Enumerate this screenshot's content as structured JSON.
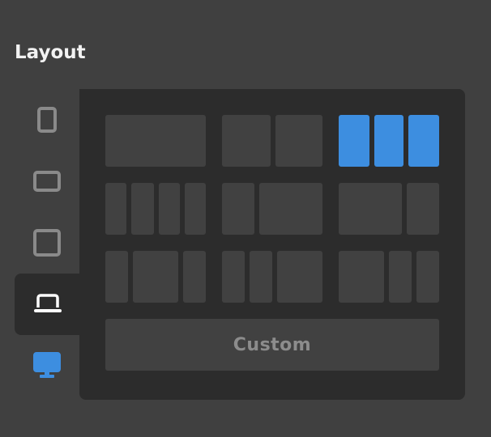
{
  "title": "Layout",
  "devices": [
    {
      "name": "phone",
      "icon": "phone-portrait-icon",
      "selected": false
    },
    {
      "name": "phone-landscape",
      "icon": "phone-landscape-icon",
      "selected": false
    },
    {
      "name": "tablet",
      "icon": "tablet-icon",
      "selected": false
    },
    {
      "name": "laptop",
      "icon": "laptop-icon",
      "selected": true
    },
    {
      "name": "desktop",
      "icon": "desktop-icon",
      "selected": false
    }
  ],
  "layout_options": [
    {
      "id": "1-col",
      "columns": [
        1
      ],
      "selected": false
    },
    {
      "id": "2-col-equal",
      "columns": [
        1,
        1
      ],
      "selected": false
    },
    {
      "id": "3-col-equal",
      "columns": [
        1,
        1,
        1
      ],
      "selected": true
    },
    {
      "id": "4-col-equal",
      "columns": [
        1,
        1,
        1,
        1
      ],
      "selected": false
    },
    {
      "id": "2-col-narrow-wide",
      "columns": [
        1,
        2
      ],
      "selected": false
    },
    {
      "id": "2-col-wide-narrow",
      "columns": [
        2,
        1
      ],
      "selected": false
    },
    {
      "id": "3-col-narrow-wide-narrow",
      "columns": [
        1,
        2,
        1
      ],
      "selected": false
    },
    {
      "id": "3-col-narrow-narrow-wide",
      "columns": [
        1,
        1,
        2
      ],
      "selected": false
    },
    {
      "id": "3-col-wide-narrow-narrow",
      "columns": [
        2,
        1,
        1
      ],
      "selected": false
    }
  ],
  "custom_label": "Custom",
  "colors": {
    "background": "#404040",
    "panel": "#2c2c2c",
    "block": "#414141",
    "accent": "#3d8ee0",
    "icon_muted": "#8a8a8a",
    "icon_active": "#ffffff",
    "custom_text": "#8c8c8c"
  }
}
